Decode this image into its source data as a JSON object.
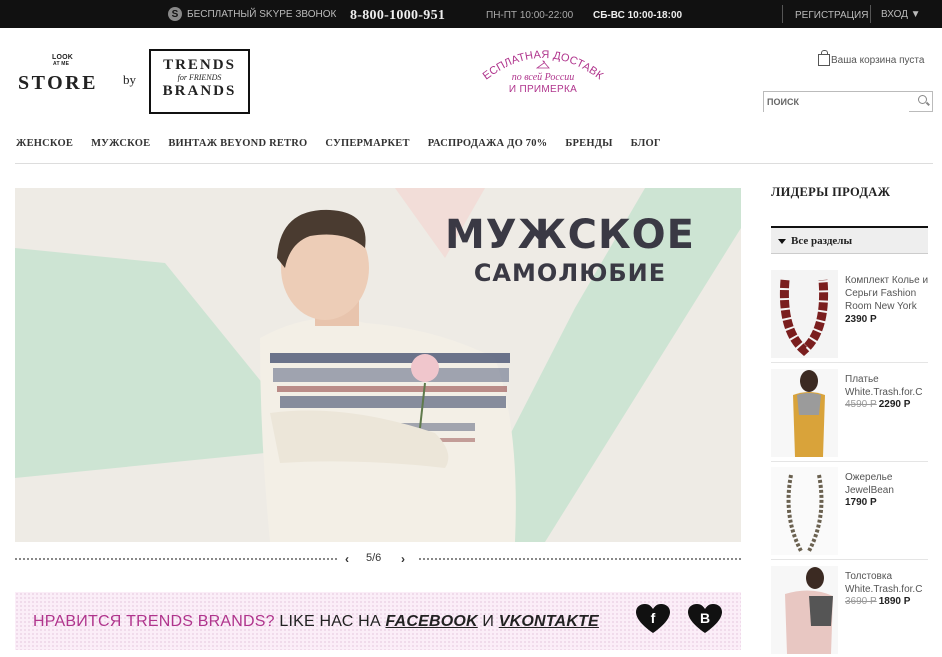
{
  "topbar": {
    "skype_icon": "skype-icon",
    "skype_label": "БЕСПЛАТНЫЙ SKYPE ЗВОНОК",
    "phone": "8-800-1000-951",
    "hours_weekdays": "ПН-ПТ 10:00-22:00",
    "hours_weekend": "СБ-ВС 10:00-18:00",
    "register": "РЕГИСТРАЦИЯ",
    "login": "ВХОД ▼"
  },
  "header": {
    "logo_small": [
      "LOOK",
      "AT ME"
    ],
    "logo_word": "STORE",
    "by": "by",
    "trends_top": "TRENDS",
    "trends_mid": "for FRIENDS",
    "trends_bottom": "BRANDS",
    "delivery_arc": "БЕСПЛАТНАЯ ДОСТАВКА",
    "delivery_line2": "по всей России",
    "delivery_line3": "И ПРИМЕРКА",
    "cart": "Ваша корзина пуста",
    "search_placeholder": "ПОИСК"
  },
  "nav": [
    "ЖЕНСКОЕ",
    "МУЖСКОЕ",
    "ВИНТАЖ BEYOND RETRO",
    "СУПЕРМАРКЕТ",
    "РАСПРОДАЖА ДО 70%",
    "БРЕНДЫ",
    "БЛОГ"
  ],
  "banner": {
    "title1": "МУЖСКОЕ",
    "title2": "САМОЛЮБИЕ",
    "colors": {
      "bg": "#eeebe5",
      "green": "#cde4d3",
      "pink": "#f2ddd8",
      "title": "#3a3944"
    }
  },
  "slider": {
    "prev": "‹",
    "next": "›",
    "counter": "5/6"
  },
  "likebar": {
    "part1": "НРАВИТСЯ TRENDS BRANDS?",
    "part2": " LIKE НАС НА ",
    "facebook": "FACEBOOK",
    "part3": " И ",
    "vkontakte": "VKONTAKTE",
    "fb_letter": "f",
    "vk_letter": "B",
    "accent": "#b0358d"
  },
  "sidebar": {
    "title": "ЛИДЕРЫ ПРОДАЖ",
    "select_label": "Все разделы",
    "products": [
      {
        "name": "Комплект Колье и Серьги Fashion Room New York",
        "old_price": "",
        "price": "2390 Р"
      },
      {
        "name": "Платье White.Trash.for.C",
        "old_price": "4590 Р",
        "price": "2290 Р"
      },
      {
        "name": "Ожерелье JewelBean",
        "old_price": "",
        "price": "1790 Р"
      },
      {
        "name": "Толстовка White.Trash.for.C",
        "old_price": "3690 Р",
        "price": "1890 Р"
      }
    ]
  }
}
